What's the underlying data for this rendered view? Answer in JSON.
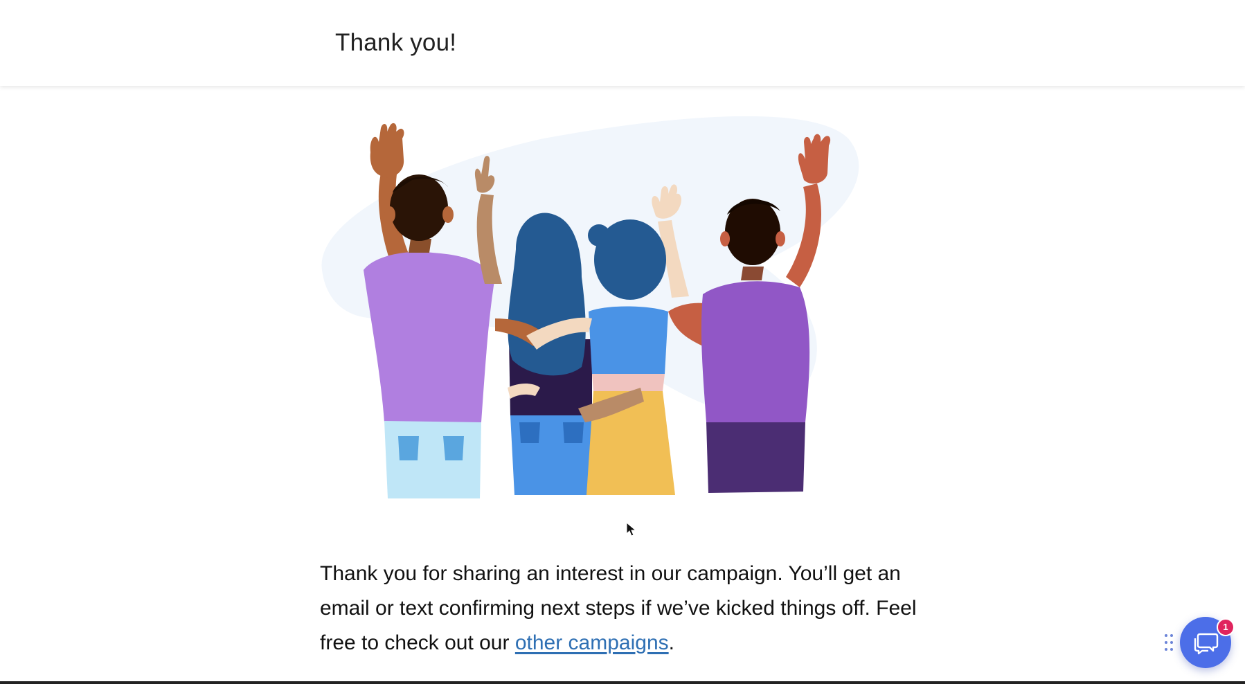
{
  "header": {
    "title": "Thank you!"
  },
  "message": {
    "body": "Thank you for sharing an interest in our campaign. You’ll get an email or text confirming next steps if we’ve kicked things off. Feel free to check out our",
    "link_label": "other campaigns",
    "trailing": "."
  },
  "chat": {
    "badge_count": "1",
    "icon": "chat-bubbles-icon"
  },
  "colors": {
    "link": "#2e6fb3",
    "chat_button": "#4c6ee8",
    "badge": "#e0245e"
  }
}
